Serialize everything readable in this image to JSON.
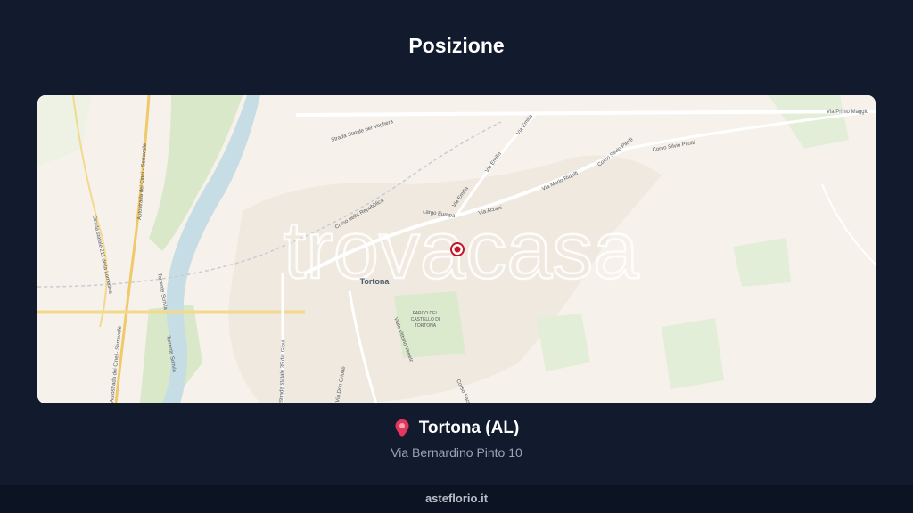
{
  "page": {
    "title": "Posizione"
  },
  "map": {
    "watermark": "trovacasa",
    "city_label": "Tortona",
    "park_label_lines": [
      "PARCO DEL",
      "CASTELLO DI",
      "TORTONA"
    ],
    "road_labels": {
      "strada_voghera": "Strada Statale per Voghera",
      "corso_repubblica": "Corso della Repubblica",
      "largo_europa": "Largo Europa",
      "via_arzani": "Via Arzani",
      "via_emilia_1": "Via Emilia",
      "via_emilia_2": "Via Emilia",
      "via_emilia_3": "Via Emilia",
      "via_mario_ridolfi": "Via Mario Ridolfi",
      "corso_pilotti_1": "Corso Silvio Pilotti",
      "corso_pilotti_2": "Corso Silvio Pilotti",
      "via_primo_maggio": "Via Primo Maggio",
      "autostrada_1": "Autostrada dei Cinei - Serravalle",
      "autostrada_2": "Autostrada dei Cinei - Serravalle",
      "strada_211": "Strada statale 211 della Lomellina",
      "strada_35": "Strada statale 35 dei Giovi",
      "via_vittorio_veneto": "Viale Vittorio Veneto",
      "via_don_orione": "Via Don Orione",
      "corso_faccini": "Corso Faccini",
      "torrente_scrivia_1": "Torrente Scrivia",
      "torrente_scrivia_2": "Torrente Scrivia"
    },
    "marker_icon": "map-marker-icon",
    "colors": {
      "background": "#f6f1ea",
      "river": "#c6dde6",
      "green": "#d8e8c8",
      "marker": "#c0182a"
    }
  },
  "location": {
    "icon": "pin-icon",
    "name": "Tortona (AL)",
    "address": "Via Bernardino Pinto 10"
  },
  "footer": {
    "site": "asteflorio.it"
  }
}
